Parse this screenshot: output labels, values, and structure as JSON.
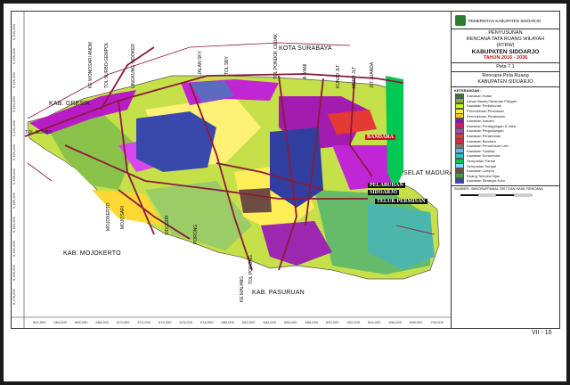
{
  "map": {
    "labels": {
      "kota_surabaya": "KOTA SURABAYA",
      "kab_gresik": "KAB. GRESIK",
      "kab_mojokerto": "KAB. MOJOKERTO",
      "kab_pasuruan": "KAB. PASURUAN",
      "selat_madura": "SELAT MADURA",
      "teluk_permisan": "TELUK PERMISAN",
      "pelabuhan": "PELABUHAN",
      "sidoarjo": "SIDOARJO",
      "bandara": "BANDARA",
      "tol_surbo": "TOL SURBO"
    },
    "roads": [
      {
        "id": "r1",
        "label": "KE WONOSARI ANOM"
      },
      {
        "id": "r2",
        "label": "TOL SURBO-GEMPOL"
      },
      {
        "id": "r3",
        "label": "LINGKUNG SIDOKER"
      },
      {
        "id": "r4",
        "label": "JALAN SKY"
      },
      {
        "id": "r5",
        "label": "TOL SBY"
      },
      {
        "id": "r6",
        "label": "TOL PONDOK CEDAK"
      },
      {
        "id": "r7",
        "label": "A. YANI"
      },
      {
        "id": "r8",
        "label": "KUNJO JLT"
      },
      {
        "id": "r9",
        "label": "MERR JLT"
      },
      {
        "id": "r10",
        "label": "JLT JUANDA"
      },
      {
        "id": "r11",
        "label": "MOJOSARI"
      },
      {
        "id": "r12",
        "label": "MOJOKERTO"
      },
      {
        "id": "r13",
        "label": "PORONG"
      },
      {
        "id": "r14",
        "label": "SIDOGIRI"
      },
      {
        "id": "r15",
        "label": "TOL PORONG"
      },
      {
        "id": "r16",
        "label": "KE MALANG"
      }
    ],
    "coords_bottom": [
      "662,500",
      "664,000",
      "666,000",
      "668,000",
      "670,000",
      "672,000",
      "674,000",
      "676,000",
      "678,000",
      "680,000",
      "682,000",
      "684,000",
      "686,000",
      "688,000",
      "690,000",
      "692,000",
      "694,000",
      "696,000",
      "698,000",
      "700,000"
    ],
    "coords_left": [
      "9,200,000",
      "9,198,000",
      "9,196,000",
      "9,194,000",
      "9,192,000",
      "9,190,000",
      "9,188,000",
      "9,186,000",
      "9,184,000",
      "9,182,000",
      "9,180,000",
      "9,178,000"
    ]
  },
  "legend": {
    "gov": "PEMERINTAH KABUPATEN SIDOARJO",
    "title1": "PENYUSUNAN",
    "title2": "RENCANA TATA RUANG WILAYAH",
    "title3": "(RTRW)",
    "title4": "KABUPATEN SIDOARJO",
    "title5": "TAHUN 2016 - 2036",
    "peta": "Peta 7.1",
    "subtitle1": "Rencana Pola Ruang",
    "subtitle2": "KABUPATEN SIDOARJO",
    "keterangan": "KETERANGAN :",
    "items": [
      {
        "label": "Kawasan Hutan",
        "color": "#2e7d32"
      },
      {
        "label": "Lahan Basah/Tanaman Pangan",
        "color": "#7cb342"
      },
      {
        "label": "Kawasan Perkebunan",
        "color": "#c6ff00"
      },
      {
        "label": "Permukiman Perkotaan",
        "color": "#ffeb3b"
      },
      {
        "label": "Permukiman Perdesaan",
        "color": "#fbc02d"
      },
      {
        "label": "Kawasan Industri",
        "color": "#7b1fa2"
      },
      {
        "label": "Kawasan Perdagangan & Jasa",
        "color": "#d81b60"
      },
      {
        "label": "Kawasan Pergudangan",
        "color": "#ab47bc"
      },
      {
        "label": "Kawasan Pertahanan",
        "color": "#e53935"
      },
      {
        "label": "Kawasan Bandara",
        "color": "#ff1744"
      },
      {
        "label": "Kawasan Peruntukan Lain",
        "color": "#8d6e63"
      },
      {
        "label": "Kawasan Tambak",
        "color": "#4fc3f7"
      },
      {
        "label": "Kawasan Konservasi",
        "color": "#26c6da"
      },
      {
        "label": "Sempadan Pantai",
        "color": "#00c853"
      },
      {
        "label": "Sempadan Sungai",
        "color": "#81d4fa"
      },
      {
        "label": "Kawasan Lumpur",
        "color": "#6d4c41"
      },
      {
        "label": "Ruang Terbuka Hijau",
        "color": "#43a047"
      },
      {
        "label": "Kawasan Strategis Kota",
        "color": "#3949ab"
      }
    ],
    "source": "SUMBER : BAKOSURTANAL 2007 DAN HASIL RENCANA",
    "page": "VII - 16"
  }
}
